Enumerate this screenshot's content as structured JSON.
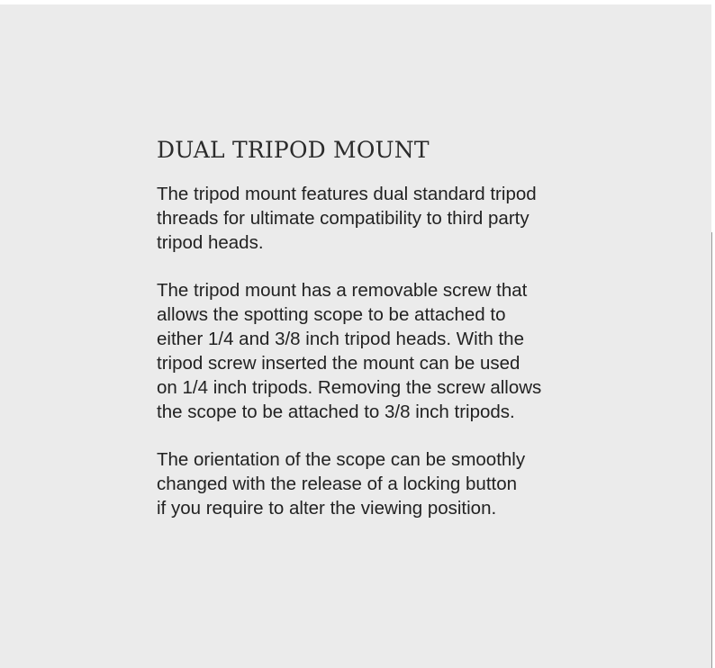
{
  "section": {
    "title": "DUAL TRIPOD MOUNT",
    "paragraphs": [
      {
        "lines": [
          "The tripod mount features dual standard tripod",
          "threads for ultimate compatibility to third party",
          "tripod heads."
        ]
      },
      {
        "lines": [
          "The tripod mount has a removable screw that",
          "allows the spotting scope to be attached to",
          "either 1/4 and 3/8 inch tripod heads. With the",
          "tripod screw inserted the mount can be used",
          "on 1/4 inch tripods. Removing the screw allows",
          "the scope to be attached to 3/8 inch tripods."
        ]
      },
      {
        "lines": [
          "The orientation of the scope can be smoothly",
          "changed with the release of a locking button",
          "if you require to alter the viewing position."
        ]
      }
    ]
  },
  "colors": {
    "panel_background": "#ebebeb",
    "text": "#222222"
  }
}
